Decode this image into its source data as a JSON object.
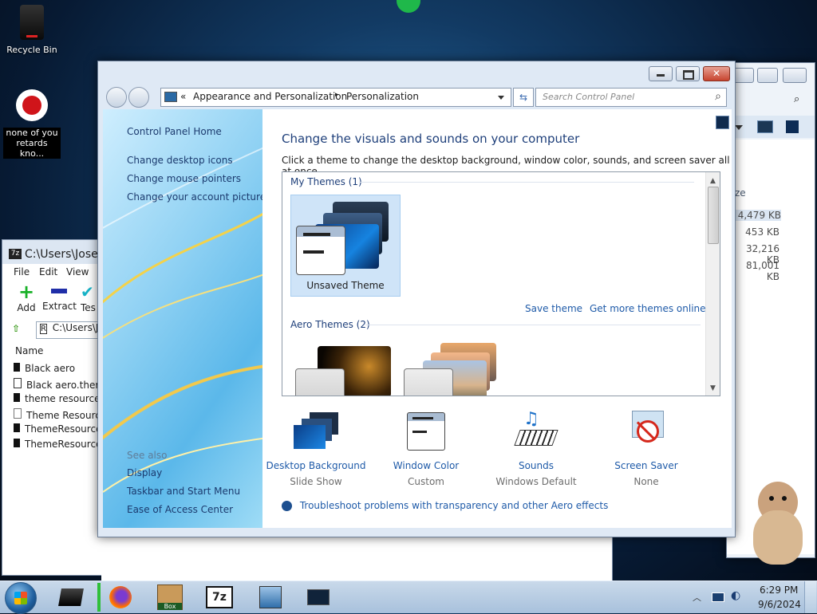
{
  "desktop": {
    "recycle_bin_label": "Recycle Bin",
    "file_label": "none of you retards kno..."
  },
  "control_panel": {
    "breadcrumb": {
      "root_chevrons": "«",
      "part1": "Appearance and Personalization",
      "sep": "▸",
      "part2": "Personalization"
    },
    "search_placeholder": "Search Control Panel",
    "left_links": [
      "Control Panel Home",
      "Change desktop icons",
      "Change mouse pointers",
      "Change your account picture"
    ],
    "see_also_title": "See also",
    "see_also_links": [
      "Display",
      "Taskbar and Start Menu",
      "Ease of Access Center"
    ],
    "title": "Change the visuals and sounds on your computer",
    "subtitle": "Click a theme to change the desktop background, window color, sounds, and screen saver all at once.",
    "my_themes_header": "My Themes (1)",
    "unsaved_theme_label": "Unsaved Theme",
    "save_theme_link": "Save theme",
    "get_more_link": "Get more themes online",
    "aero_themes_header": "Aero Themes (2)",
    "bottom": [
      {
        "title": "Desktop Background",
        "value": "Slide Show"
      },
      {
        "title": "Window Color",
        "value": "Custom"
      },
      {
        "title": "Sounds",
        "value": "Windows Default"
      },
      {
        "title": "Screen Saver",
        "value": "None"
      }
    ],
    "troubleshoot_link": "Troubleshoot problems with transparency and other Aero effects"
  },
  "zip_window": {
    "title": "C:\\Users\\Josep",
    "menu": [
      "File",
      "Edit",
      "View"
    ],
    "toolbar": [
      "Add",
      "Extract",
      "Tes"
    ],
    "path": "C:\\Users\\Jo",
    "column_name": "Name",
    "files": [
      "Black aero",
      "Black aero.theme",
      "theme resource c",
      "Theme Resource",
      "ThemeResourceC",
      "ThemeResourceC"
    ]
  },
  "explorer_back": {
    "column_size": "ze",
    "sizes": [
      "4,479 KB",
      "453 KB",
      "32,216 KB",
      "81,001 KB"
    ]
  },
  "taskbar": {
    "time": "6:29 PM",
    "date": "9/6/2024",
    "sevenzip_label": "7z",
    "box_label": "Box"
  },
  "colors": {
    "link_blue": "#1e5aa8",
    "heading_navy": "#1e3f7a",
    "taskbar": "#b9cde3"
  }
}
